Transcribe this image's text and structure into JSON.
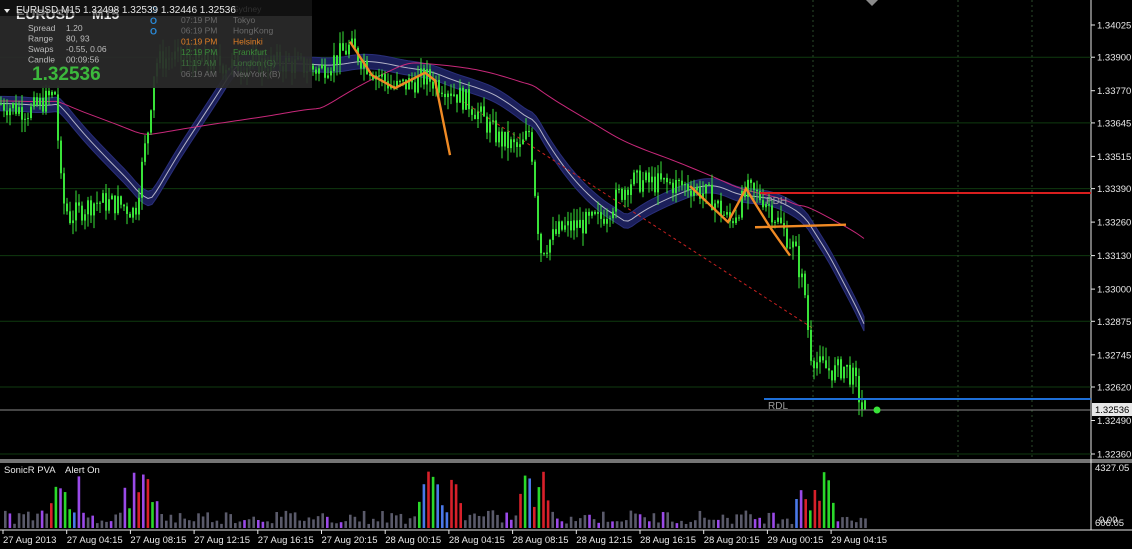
{
  "window": {
    "symbol_dropdown_label": "EURUSD,M15",
    "ohlc_readout": "1.32498 1.32539 1.32446 1.32536"
  },
  "info_panel": {
    "pair_big": "EURUSD",
    "timeframe_big": "M15",
    "rows": [
      {
        "label": "Spread",
        "value": "1.20"
      },
      {
        "label": "Range",
        "value": "80, 93"
      },
      {
        "label": "Swaps",
        "value": "-0.55, 0.06"
      },
      {
        "label": "Candle",
        "value": "00:09:56"
      }
    ],
    "bid": "1.32536",
    "bid_color": "#3cb83c"
  },
  "sessions": [
    {
      "time": "",
      "name": "Sydney",
      "color": "#6a6a6a",
      "indicator": "O"
    },
    {
      "time": "07:19 PM",
      "name": "Tokyo",
      "color": "#6a6a6a",
      "indicator": "O"
    },
    {
      "time": "06:19 PM",
      "name": "HongKong",
      "color": "#6a6a6a",
      "indicator": "O"
    },
    {
      "time": "01:19 PM",
      "name": "Helsinki",
      "color": "#e07f26",
      "indicator": ""
    },
    {
      "time": "12:19 PM",
      "name": "Frankfurt",
      "color": "#3a8a3a",
      "indicator": ""
    },
    {
      "time": "11:19 AM",
      "name": "London (G)",
      "color": "#3a6a3a",
      "indicator": ""
    },
    {
      "time": "06:19 AM",
      "name": "NewYork (B)",
      "color": "#6a6a6a",
      "indicator": ""
    }
  ],
  "price_axis": {
    "ticks": [
      "1.34025",
      "1.33900",
      "1.33770",
      "1.33645",
      "1.33515",
      "1.33390",
      "1.33260",
      "1.33130",
      "1.33000",
      "1.32875",
      "1.32745",
      "1.32620",
      "1.32490",
      "1.32360"
    ],
    "current_price_label": "1.32536"
  },
  "time_axis": {
    "ticks": [
      "27 Aug 2013",
      "27 Aug 04:15",
      "27 Aug 08:15",
      "27 Aug 12:15",
      "27 Aug 16:15",
      "27 Aug 20:15",
      "28 Aug 00:15",
      "28 Aug 04:15",
      "28 Aug 08:15",
      "28 Aug 12:15",
      "28 Aug 16:15",
      "28 Aug 20:15",
      "29 Aug 00:15",
      "29 Aug 04:15"
    ]
  },
  "levels": {
    "pdh_label": "PDH",
    "rdl_label": "RDL",
    "pdh_color": "#d81e1e",
    "rdl_color": "#1e6fd8"
  },
  "volume_panel": {
    "indicator_name": "SonicR PVA",
    "alert_label": "Alert On",
    "max_label": "4327.05",
    "min_label": "0.00",
    "bottom_label": "606.05"
  },
  "colors": {
    "candles": "#39e339",
    "band_fill": "#1b1f5a",
    "band_line": "#b4b4c8",
    "ma_magenta": "#c8287a",
    "zigzag": "#f08a24",
    "trend_dashed": "#c82020",
    "grid": "#0f3a0f"
  }
}
